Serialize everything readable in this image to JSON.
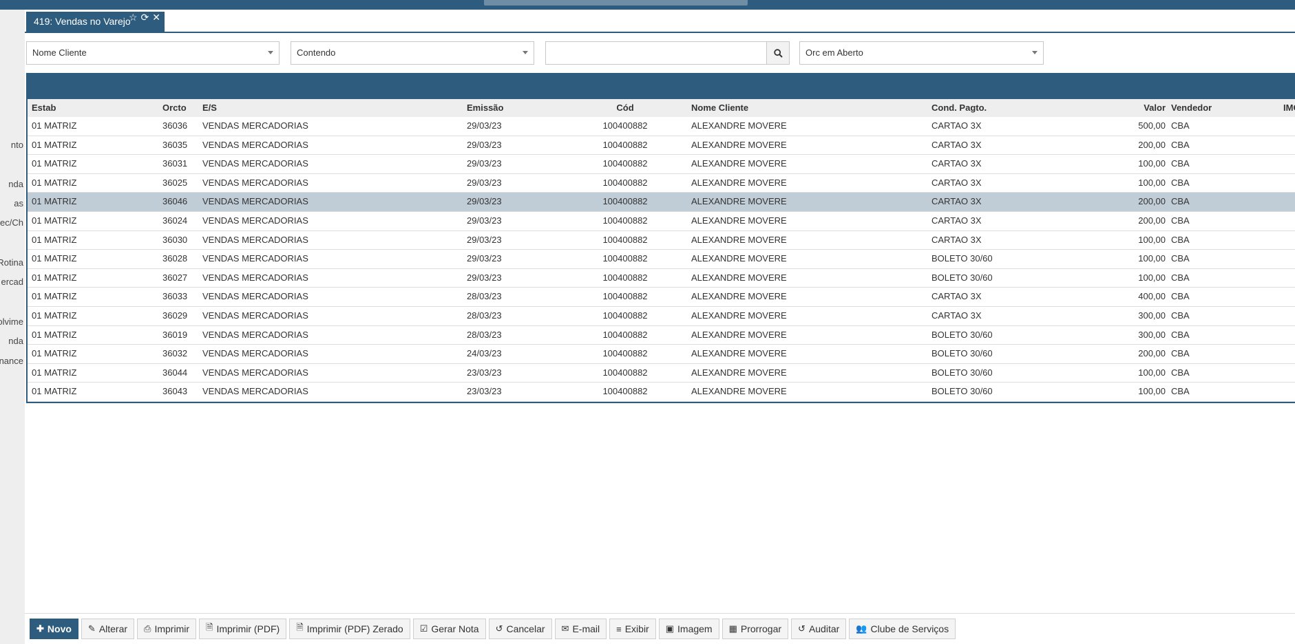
{
  "left_fragments": [
    "nto",
    "nda",
    "as",
    "tec/Ch",
    "Rotina",
    "ercad",
    "olvime",
    "nda",
    "nance"
  ],
  "tab": {
    "title": "419: Vendas no Varejo"
  },
  "filters": {
    "field": "Nome Cliente",
    "operator": "Contendo",
    "search_value": "",
    "status": "Orc em Aberto"
  },
  "table": {
    "columns": {
      "estab": "Estab",
      "orcto": "Orcto",
      "es": "E/S",
      "emissao": "Emissão",
      "cod": "Cód",
      "nome": "Nome Cliente",
      "cond": "Cond. Pagto.",
      "valor": "Valor",
      "vendedor": "Vendedor",
      "imc": "IMC"
    },
    "selected_index": 4,
    "rows": [
      {
        "estab": "01 MATRIZ",
        "orcto": "36036",
        "es": "VENDAS MERCADORIAS",
        "emissao": "29/03/23",
        "cod": "100400882",
        "nome": "ALEXANDRE MOVERE",
        "cond": "CARTAO 3X",
        "valor": "500,00",
        "vendedor": "CBA"
      },
      {
        "estab": "01 MATRIZ",
        "orcto": "36035",
        "es": "VENDAS MERCADORIAS",
        "emissao": "29/03/23",
        "cod": "100400882",
        "nome": "ALEXANDRE MOVERE",
        "cond": "CARTAO 3X",
        "valor": "200,00",
        "vendedor": "CBA"
      },
      {
        "estab": "01 MATRIZ",
        "orcto": "36031",
        "es": "VENDAS MERCADORIAS",
        "emissao": "29/03/23",
        "cod": "100400882",
        "nome": "ALEXANDRE MOVERE",
        "cond": "CARTAO 3X",
        "valor": "100,00",
        "vendedor": "CBA"
      },
      {
        "estab": "01 MATRIZ",
        "orcto": "36025",
        "es": "VENDAS MERCADORIAS",
        "emissao": "29/03/23",
        "cod": "100400882",
        "nome": "ALEXANDRE MOVERE",
        "cond": "CARTAO 3X",
        "valor": "100,00",
        "vendedor": "CBA"
      },
      {
        "estab": "01 MATRIZ",
        "orcto": "36046",
        "es": "VENDAS MERCADORIAS",
        "emissao": "29/03/23",
        "cod": "100400882",
        "nome": "ALEXANDRE MOVERE",
        "cond": "CARTAO 3X",
        "valor": "200,00",
        "vendedor": "CBA"
      },
      {
        "estab": "01 MATRIZ",
        "orcto": "36024",
        "es": "VENDAS MERCADORIAS",
        "emissao": "29/03/23",
        "cod": "100400882",
        "nome": "ALEXANDRE MOVERE",
        "cond": "CARTAO 3X",
        "valor": "200,00",
        "vendedor": "CBA"
      },
      {
        "estab": "01 MATRIZ",
        "orcto": "36030",
        "es": "VENDAS MERCADORIAS",
        "emissao": "29/03/23",
        "cod": "100400882",
        "nome": "ALEXANDRE MOVERE",
        "cond": "CARTAO 3X",
        "valor": "100,00",
        "vendedor": "CBA"
      },
      {
        "estab": "01 MATRIZ",
        "orcto": "36028",
        "es": "VENDAS MERCADORIAS",
        "emissao": "29/03/23",
        "cod": "100400882",
        "nome": "ALEXANDRE MOVERE",
        "cond": "BOLETO 30/60",
        "valor": "100,00",
        "vendedor": "CBA"
      },
      {
        "estab": "01 MATRIZ",
        "orcto": "36027",
        "es": "VENDAS MERCADORIAS",
        "emissao": "29/03/23",
        "cod": "100400882",
        "nome": "ALEXANDRE MOVERE",
        "cond": "BOLETO 30/60",
        "valor": "100,00",
        "vendedor": "CBA"
      },
      {
        "estab": "01 MATRIZ",
        "orcto": "36033",
        "es": "VENDAS MERCADORIAS",
        "emissao": "28/03/23",
        "cod": "100400882",
        "nome": "ALEXANDRE MOVERE",
        "cond": "CARTAO 3X",
        "valor": "400,00",
        "vendedor": "CBA"
      },
      {
        "estab": "01 MATRIZ",
        "orcto": "36029",
        "es": "VENDAS MERCADORIAS",
        "emissao": "28/03/23",
        "cod": "100400882",
        "nome": "ALEXANDRE MOVERE",
        "cond": "CARTAO 3X",
        "valor": "300,00",
        "vendedor": "CBA"
      },
      {
        "estab": "01 MATRIZ",
        "orcto": "36019",
        "es": "VENDAS MERCADORIAS",
        "emissao": "28/03/23",
        "cod": "100400882",
        "nome": "ALEXANDRE MOVERE",
        "cond": "BOLETO 30/60",
        "valor": "300,00",
        "vendedor": "CBA"
      },
      {
        "estab": "01 MATRIZ",
        "orcto": "36032",
        "es": "VENDAS MERCADORIAS",
        "emissao": "24/03/23",
        "cod": "100400882",
        "nome": "ALEXANDRE MOVERE",
        "cond": "BOLETO 30/60",
        "valor": "200,00",
        "vendedor": "CBA"
      },
      {
        "estab": "01 MATRIZ",
        "orcto": "36044",
        "es": "VENDAS MERCADORIAS",
        "emissao": "23/03/23",
        "cod": "100400882",
        "nome": "ALEXANDRE MOVERE",
        "cond": "BOLETO 30/60",
        "valor": "100,00",
        "vendedor": "CBA"
      },
      {
        "estab": "01 MATRIZ",
        "orcto": "36043",
        "es": "VENDAS MERCADORIAS",
        "emissao": "23/03/23",
        "cod": "100400882",
        "nome": "ALEXANDRE MOVERE",
        "cond": "BOLETO 30/60",
        "valor": "100,00",
        "vendedor": "CBA"
      }
    ]
  },
  "toolbar": [
    {
      "id": "novo",
      "label": "Novo",
      "icon": "plus-icon",
      "glyph": "✚",
      "primary": true
    },
    {
      "id": "alterar",
      "label": "Alterar",
      "icon": "pencil-icon",
      "glyph": "✎"
    },
    {
      "id": "imprimir",
      "label": "Imprimir",
      "icon": "printer-icon",
      "glyph": "⎙"
    },
    {
      "id": "imprimir-pdf",
      "label": "Imprimir (PDF)",
      "icon": "file-pdf-icon",
      "glyph": "🗎"
    },
    {
      "id": "imprimir-pdf-zerado",
      "label": "Imprimir (PDF) Zerado",
      "icon": "file-pdf-icon",
      "glyph": "🗎"
    },
    {
      "id": "gerar-nota",
      "label": "Gerar Nota",
      "icon": "check-square-icon",
      "glyph": "☑"
    },
    {
      "id": "cancelar",
      "label": "Cancelar",
      "icon": "undo-icon",
      "glyph": "↺"
    },
    {
      "id": "email",
      "label": "E-mail",
      "icon": "envelope-icon",
      "glyph": "✉"
    },
    {
      "id": "exibir",
      "label": "Exibir",
      "icon": "list-icon",
      "glyph": "≡"
    },
    {
      "id": "imagem",
      "label": "Imagem",
      "icon": "image-icon",
      "glyph": "▣"
    },
    {
      "id": "prorrogar",
      "label": "Prorrogar",
      "icon": "calendar-icon",
      "glyph": "▦"
    },
    {
      "id": "auditar",
      "label": "Auditar",
      "icon": "history-icon",
      "glyph": "↺"
    },
    {
      "id": "clube",
      "label": "Clube de Serviços",
      "icon": "users-icon",
      "glyph": "👥"
    }
  ]
}
